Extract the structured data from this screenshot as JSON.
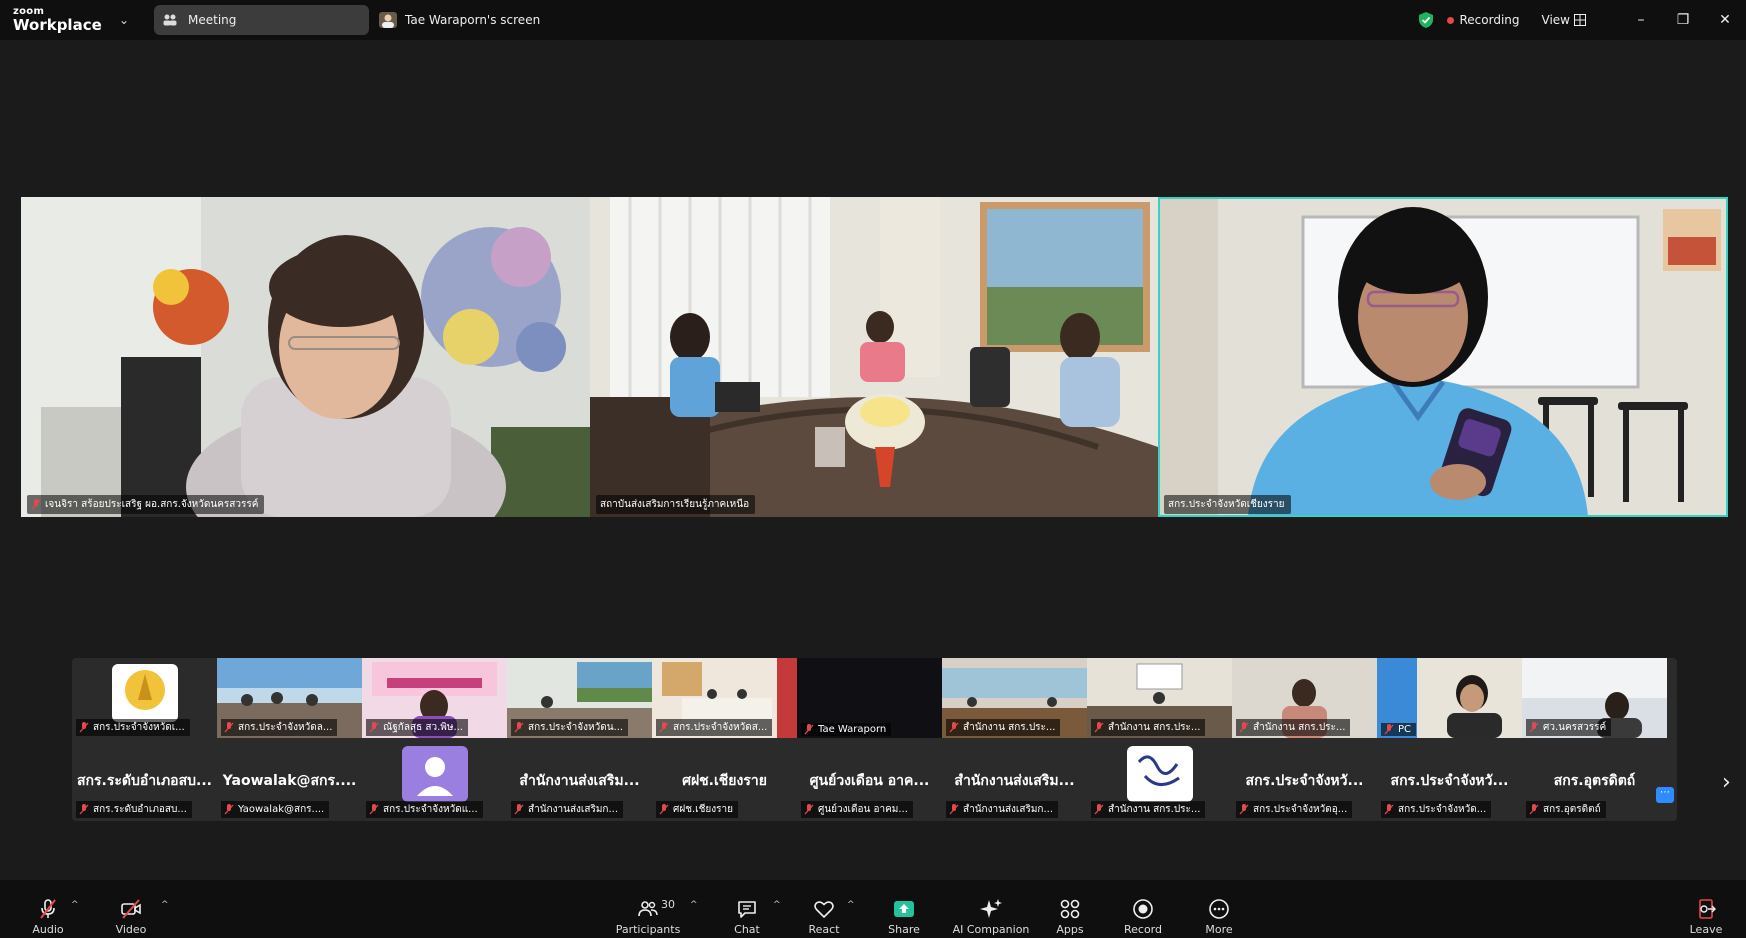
{
  "titlebar": {
    "brand_top": "zoom",
    "brand_bottom": "Workplace",
    "meeting_tab": "Meeting",
    "screen_tab": "Tae Waraporn's screen",
    "recording": "Recording",
    "view": "View"
  },
  "main_videos": [
    {
      "label": "เจนจิรา สร้อยประเสริฐ ผอ.สกร.จังหวัดนครสวรรค์"
    },
    {
      "label": "สถาบันส่งเสริมการเรียนรู้ภาคเหนือ"
    },
    {
      "label": "สกร.ประจำจังหวัดเชียงราย"
    }
  ],
  "gallery_top": [
    {
      "label": "สกร.ประจำจังหวัดเ..."
    },
    {
      "label": "สกร.ประจำจังหวัดล..."
    },
    {
      "label": "ณัฐกัลสุธ สว.พิษ..."
    },
    {
      "label": "สกร.ประจำจังหวัดน..."
    },
    {
      "label": "สกร.ประจำจังหวัดส..."
    },
    {
      "label": "Tae Waraporn"
    },
    {
      "label": "สำนักงาน สกร.ประ..."
    },
    {
      "label": "สำนักงาน สกร.ประ..."
    },
    {
      "label": "สำนักงาน สกร.ประ..."
    },
    {
      "label": "PC"
    },
    {
      "label": "ศว.นครสวรรค์"
    }
  ],
  "gallery_bottom": [
    {
      "name": "สกร.ระดับอำเภอสบ...",
      "label": "สกร.ระดับอำเภอสบ..."
    },
    {
      "name": "Yaowalak@สกร....",
      "label": "Yaowalak@สกร...."
    },
    {
      "name": "",
      "label": "สกร.ประจำจังหวัดแ..."
    },
    {
      "name": "สำนักงานส่งเสริม...",
      "label": "สำนักงานส่งเสริมก..."
    },
    {
      "name": "ศฝช.เชียงราย",
      "label": "ศฝช.เชียงราย"
    },
    {
      "name": "ศูนย์วงเดือน อาค...",
      "label": "ศูนย์วงเดือน อาคม..."
    },
    {
      "name": "สำนักงานส่งเสริม...",
      "label": "สำนักงานส่งเสริมก..."
    },
    {
      "name": "",
      "label": "สำนักงาน สกร.ประ..."
    },
    {
      "name": "สกร.ประจำจังหวั...",
      "label": "สกร.ประจำจังหวัดอุ..."
    },
    {
      "name": "สกร.ประจำจังหวั...",
      "label": "สกร.ประจำจังหวัด..."
    },
    {
      "name": "สกร.อุตรดิตถ์",
      "label": "สกร.อุตรดิตถ์"
    }
  ],
  "toolbar": {
    "audio": "Audio",
    "video": "Video",
    "participants": "Participants",
    "participants_count": "30",
    "chat": "Chat",
    "react": "React",
    "share": "Share",
    "ai_companion": "AI Companion",
    "apps": "Apps",
    "record": "Record",
    "more": "More",
    "leave": "Leave"
  },
  "colors": {
    "active_speaker": "#35d3c4",
    "recording": "#e5484d",
    "share": "#25c29c",
    "leave": "#e5484d"
  }
}
